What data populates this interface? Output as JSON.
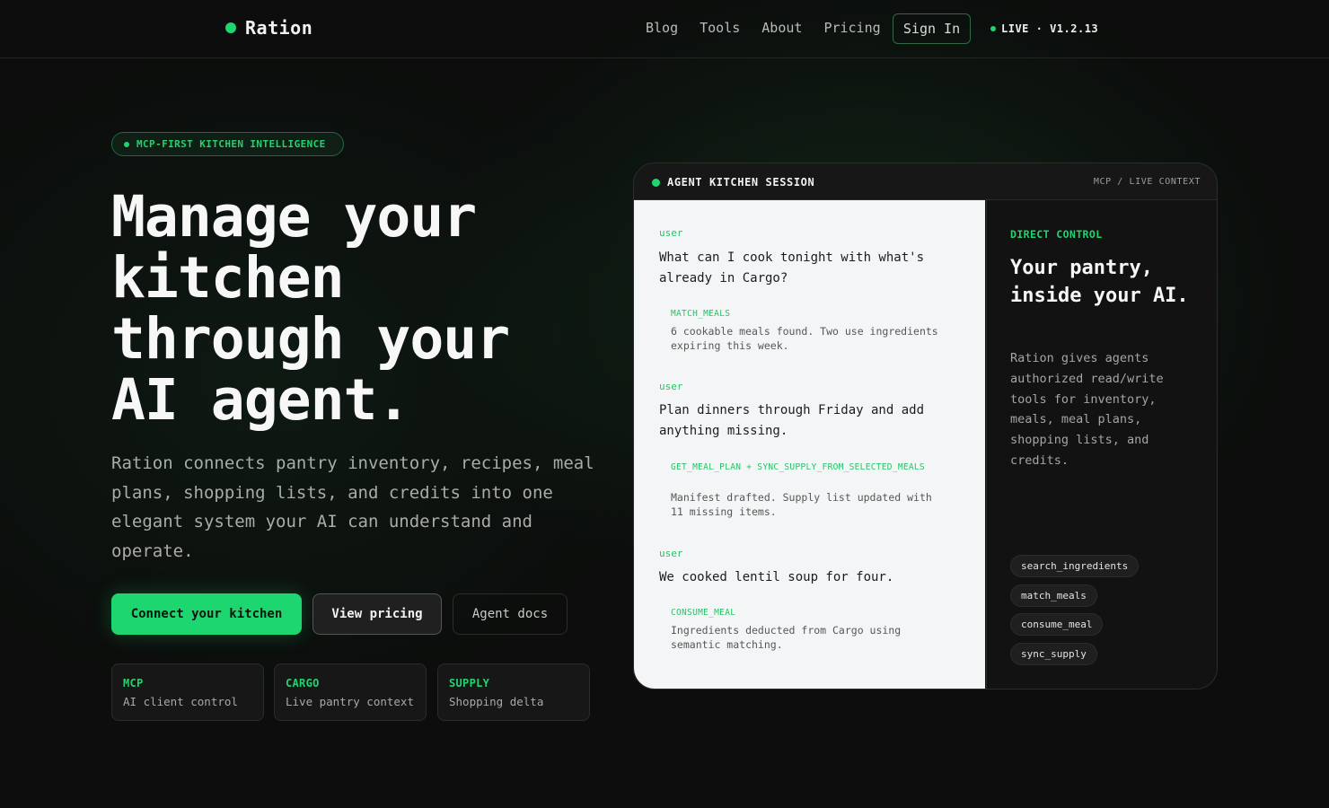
{
  "header": {
    "brand": "Ration",
    "nav": [
      "Blog",
      "Tools",
      "About",
      "Pricing"
    ],
    "signin": "Sign In",
    "status": "LIVE · V1.2.13"
  },
  "hero": {
    "badge": "MCP-FIRST KITCHEN INTELLIGENCE",
    "title_lines": [
      "Manage your",
      "kitchen",
      "through your",
      "AI agent."
    ],
    "subtitle": "Ration connects pantry inventory, recipes, meal plans, shopping lists, and credits into one elegant system your AI can understand and operate.",
    "buttons": {
      "primary": "Connect your kitchen",
      "secondary": "View pricing",
      "ghost": "Agent docs"
    },
    "stats": [
      {
        "key": "MCP",
        "value": "AI client control"
      },
      {
        "key": "CARGO",
        "value": "Live pantry context"
      },
      {
        "key": "SUPPLY",
        "value": "Shopping delta"
      }
    ]
  },
  "session": {
    "title": "AGENT KITCHEN SESSION",
    "context": "MCP / LIVE CONTEXT",
    "messages": [
      {
        "who": "user",
        "text": "What can I cook tonight with what's already in Cargo?",
        "tool": "MATCH_MEALS",
        "result": "6 cookable meals found. Two use ingredients expiring this week."
      },
      {
        "who": "user",
        "text": "Plan dinners through Friday and add anything missing.",
        "tool": "GET_MEAL_PLAN + SYNC_SUPPLY_FROM_SELECTED_MEALS",
        "result": "Manifest drafted. Supply list updated with 11 missing items."
      },
      {
        "who": "user",
        "text": "We cooked lentil soup for four.",
        "tool": "CONSUME_MEAL",
        "result": "Ingredients deducted from Cargo using semantic matching."
      }
    ],
    "control": {
      "label": "DIRECT CONTROL",
      "heading": "Your pantry, inside your AI.",
      "body": "Ration gives agents authorized read/write tools for inventory, meals, meal plans, shopping lists, and credits.",
      "tools": [
        "search_ingredients",
        "match_meals",
        "consume_meal",
        "sync_supply"
      ]
    }
  },
  "colors": {
    "accent": "#1ed66f",
    "background": "#0c0d0c",
    "chat_background": "#f4f5f6"
  }
}
